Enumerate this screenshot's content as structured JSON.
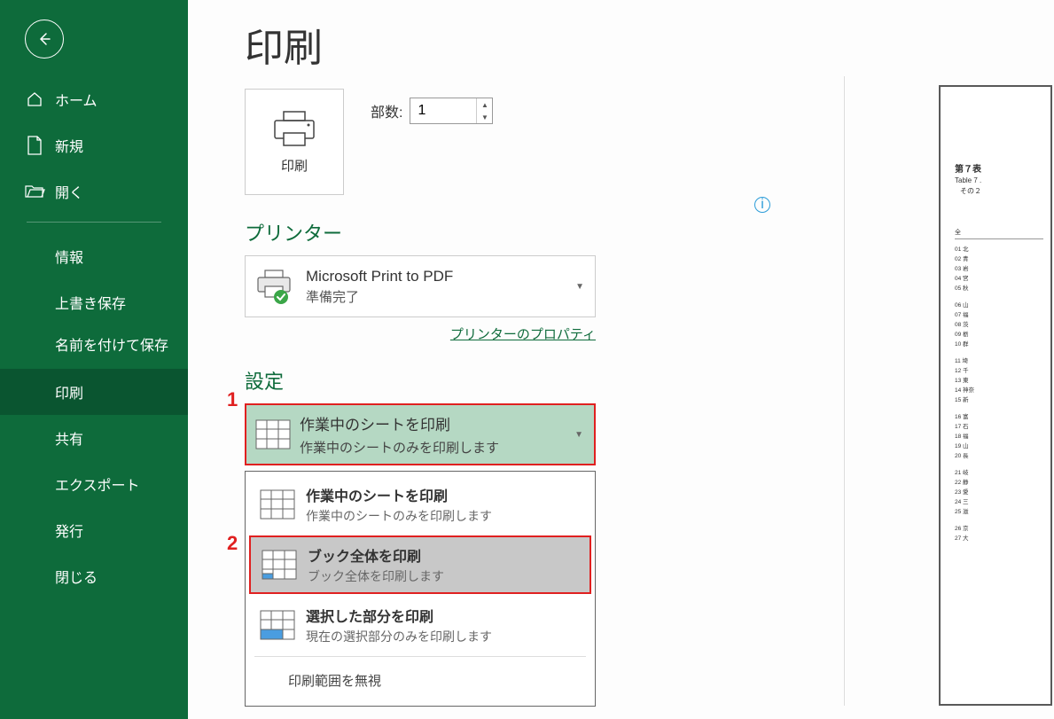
{
  "page": {
    "title": "印刷"
  },
  "sidebar": {
    "home": "ホーム",
    "new": "新規",
    "open": "開く",
    "info": "情報",
    "save": "上書き保存",
    "save_as": "名前を付けて保存",
    "print": "印刷",
    "share": "共有",
    "export": "エクスポート",
    "publish": "発行",
    "close": "閉じる"
  },
  "print_button": {
    "label": "印刷"
  },
  "copies": {
    "label": "部数:",
    "value": "1"
  },
  "printer_section": {
    "heading": "プリンター"
  },
  "printer": {
    "name": "Microsoft Print to PDF",
    "status": "準備完了",
    "properties_link": "プリンターのプロパティ"
  },
  "settings_section": {
    "heading": "設定"
  },
  "settings_selected": {
    "title": "作業中のシートを印刷",
    "desc": "作業中のシートのみを印刷します"
  },
  "settings_options": [
    {
      "title": "作業中のシートを印刷",
      "desc": "作業中のシートのみを印刷します"
    },
    {
      "title": "ブック全体を印刷",
      "desc": "ブック全体を印刷します"
    },
    {
      "title": "選択した部分を印刷",
      "desc": "現在の選択部分のみを印刷します"
    }
  ],
  "settings_footer": "印刷範囲を無視",
  "annotations": {
    "one": "1",
    "two": "2"
  },
  "preview": {
    "t7": "第７表",
    "t7en": "Table 7 .",
    "t7sub": "その２",
    "total_label": "全",
    "rows": [
      "01 北",
      "02 青",
      "03 岩",
      "04 宮",
      "05 秋",
      "",
      "06 山",
      "07 福",
      "08 茨",
      "09 栃",
      "10 群",
      "",
      "11 埼",
      "12 千",
      "13 東",
      "14 神奈",
      "15 新",
      "",
      "16 富",
      "17 石",
      "18 福",
      "19 山",
      "20 長",
      "",
      "21 岐",
      "22 静",
      "23 愛",
      "24 三",
      "25 滋",
      "",
      "26 京",
      "27 大"
    ]
  }
}
